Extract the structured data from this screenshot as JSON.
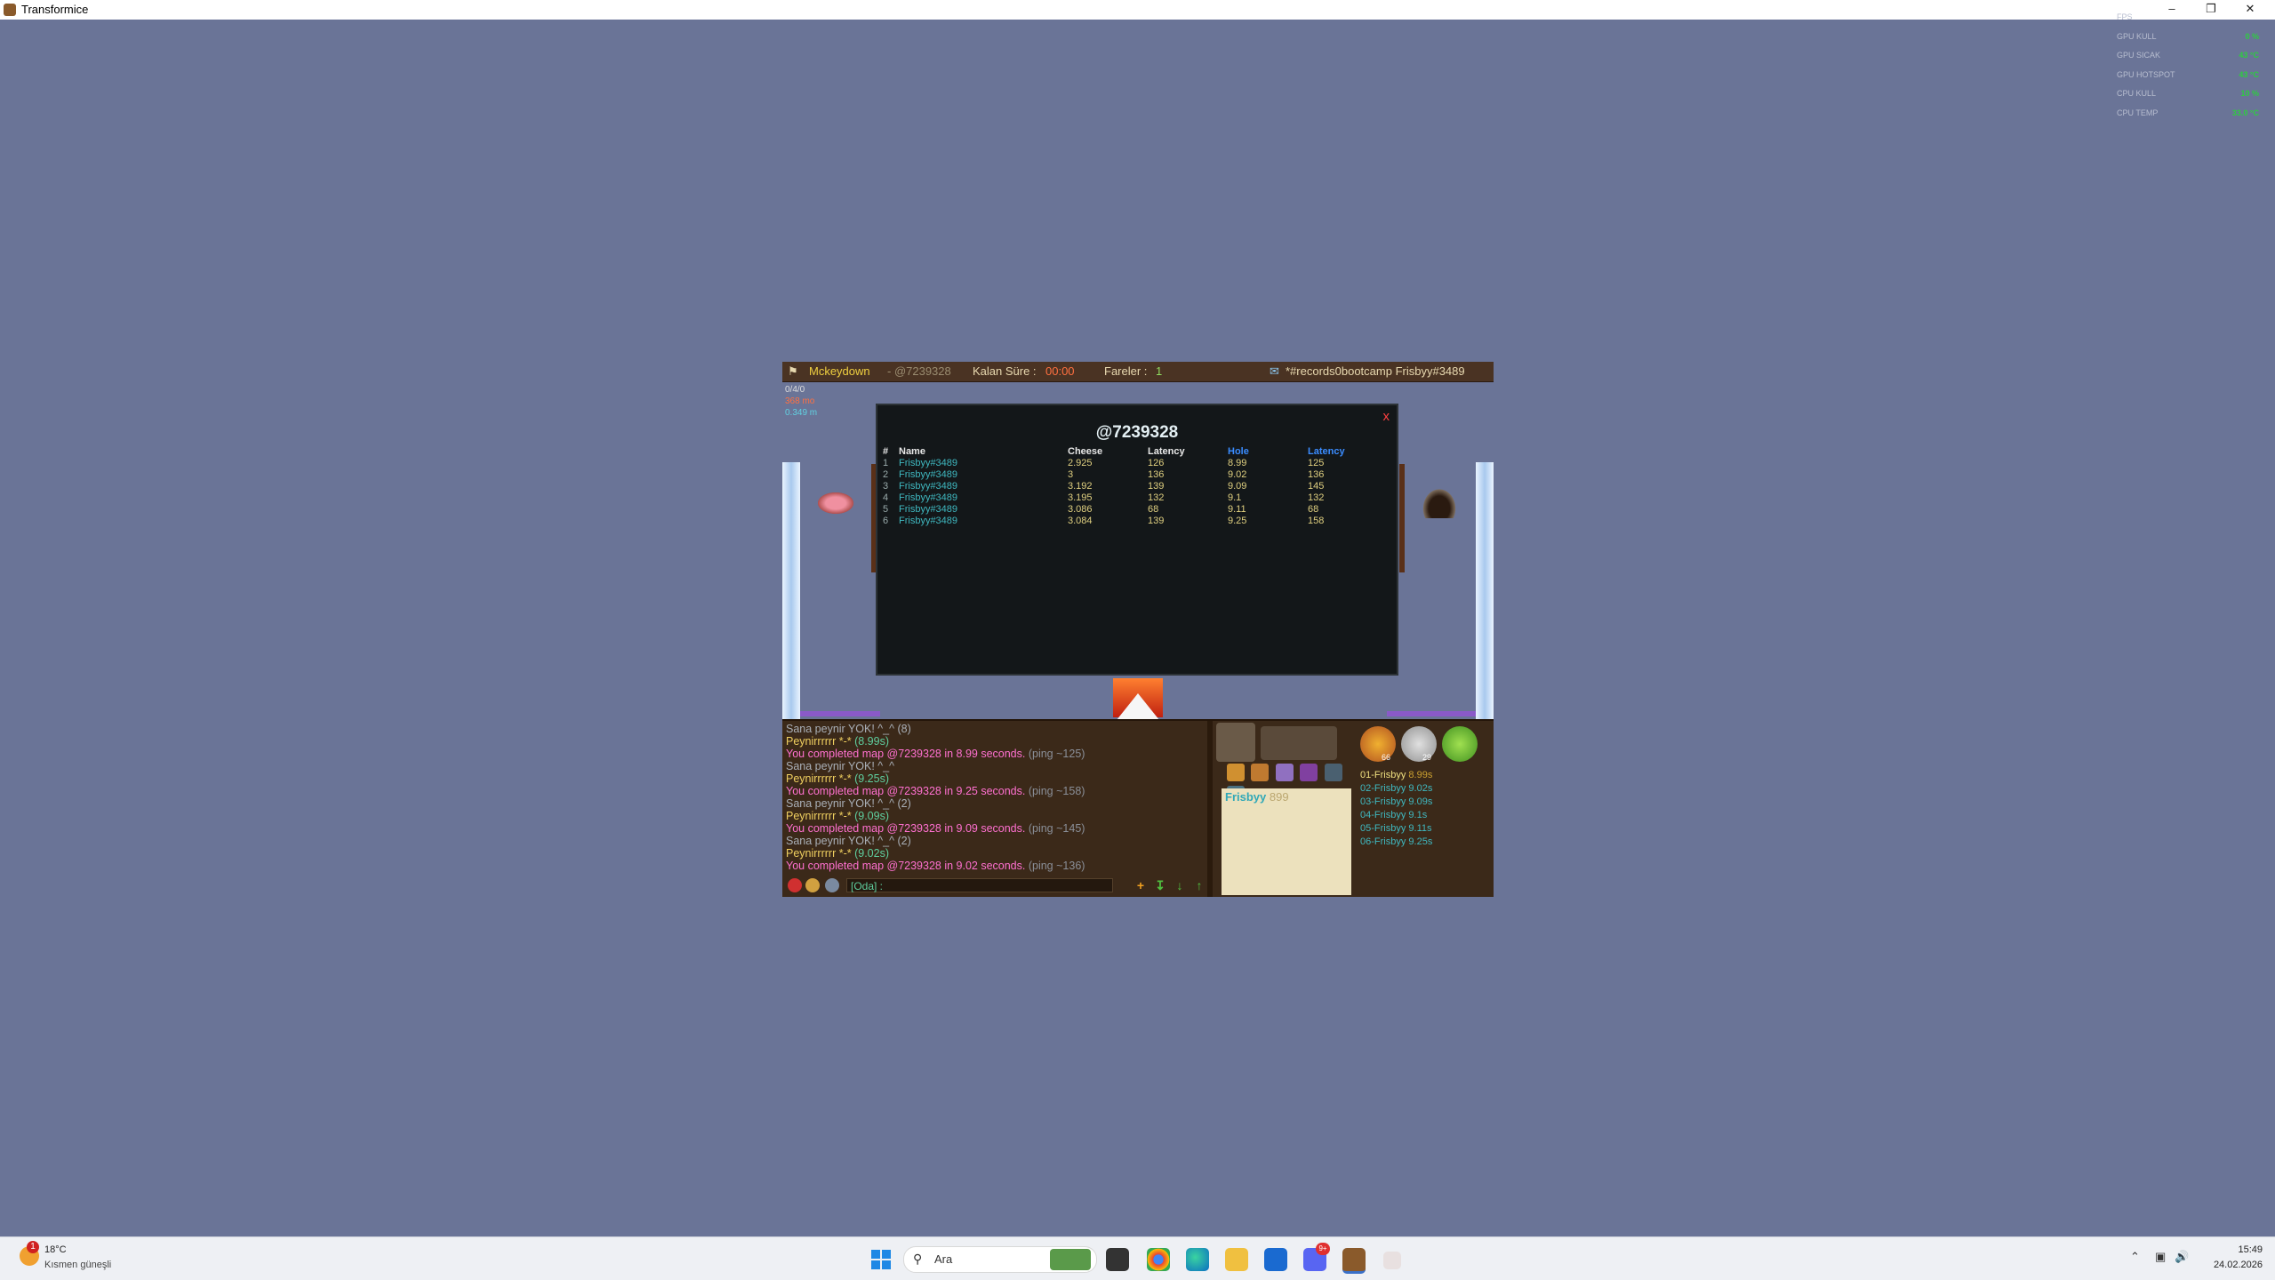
{
  "window": {
    "title": "Transformice"
  },
  "overlay": {
    "rows": [
      {
        "label": "FPS",
        "value": ""
      },
      {
        "label": "GPU KULL",
        "value": "0 %"
      },
      {
        "label": "GPU SICAK",
        "value": "43 °C"
      },
      {
        "label": "GPU HOTSPOT",
        "value": "43 °C"
      },
      {
        "label": "CPU KULL",
        "value": "10 %"
      },
      {
        "label": "CPU TEMP",
        "value": "33.0 °C"
      }
    ]
  },
  "game": {
    "topbar": {
      "map_author": "Mckeydown",
      "map_code": "- @7239328",
      "time_label": "Kalan Süre :",
      "time_value": "00:00",
      "mice_label": "Fareler :",
      "mice_value": "1",
      "room": "*#records0bootcamp Frisbyy#3489"
    },
    "small_stats": [
      "0/4/0",
      "368 mo",
      "0.349 m"
    ],
    "records": {
      "title": "@7239328",
      "close": "x",
      "headers": [
        "#",
        "Name",
        "Cheese",
        "Latency",
        "Hole",
        "Latency"
      ],
      "rows": [
        [
          "1",
          "Frisbyy#3489",
          "2.925",
          "126",
          "8.99",
          "125"
        ],
        [
          "2",
          "Frisbyy#3489",
          "3",
          "136",
          "9.02",
          "136"
        ],
        [
          "3",
          "Frisbyy#3489",
          "3.192",
          "139",
          "9.09",
          "145"
        ],
        [
          "4",
          "Frisbyy#3489",
          "3.195",
          "132",
          "9.1",
          "132"
        ],
        [
          "5",
          "Frisbyy#3489",
          "3.086",
          "68",
          "9.11",
          "68"
        ],
        [
          "6",
          "Frisbyy#3489",
          "3.084",
          "139",
          "9.25",
          "158"
        ]
      ]
    },
    "chat": [
      {
        "type": "grey",
        "text": "Sana peynir YOK! ^_^ (8)"
      },
      {
        "type": "yg",
        "a": "Peynirrrrrr *-* ",
        "b": "(8.99s)"
      },
      {
        "type": "pink",
        "a": "You completed map @7239328 in 8.99 seconds. ",
        "b": "(ping ~125)"
      },
      {
        "type": "grey",
        "text": "Sana peynir YOK! ^_^"
      },
      {
        "type": "yg",
        "a": "Peynirrrrrr *-* ",
        "b": "(9.25s)"
      },
      {
        "type": "pink",
        "a": "You completed map @7239328 in 9.25 seconds. ",
        "b": "(ping ~158)"
      },
      {
        "type": "grey",
        "text": "Sana peynir YOK! ^_^ (2)"
      },
      {
        "type": "yg",
        "a": "Peynirrrrrr *-* ",
        "b": "(9.09s)"
      },
      {
        "type": "pink",
        "a": "You completed map @7239328 in 9.09 seconds. ",
        "b": "(ping ~145)"
      },
      {
        "type": "grey",
        "text": "Sana peynir YOK! ^_^ (2)"
      },
      {
        "type": "yg",
        "a": "Peynirrrrrr *-* ",
        "b": "(9.02s)"
      },
      {
        "type": "pink",
        "a": "You completed map @7239328 in 9.02 seconds. ",
        "b": "(ping ~136)"
      }
    ],
    "chat_input": {
      "value": "[Oda] :"
    },
    "profile": {
      "name": "Frisbyy",
      "score": "899"
    },
    "badges": [
      {
        "count": "66"
      },
      {
        "count": "29"
      },
      {
        "count": ""
      }
    ],
    "ranking": [
      {
        "name": "01-Frisbyy",
        "time": "8.99s"
      },
      {
        "name": "02-Frisbyy",
        "time": "9.02s"
      },
      {
        "name": "03-Frisbyy",
        "time": "9.09s"
      },
      {
        "name": "04-Frisbyy",
        "time": "9.1s"
      },
      {
        "name": "05-Frisbyy",
        "time": "9.11s"
      },
      {
        "name": "06-Frisbyy",
        "time": "9.25s"
      }
    ]
  },
  "taskbar": {
    "weather": {
      "badge": "1",
      "temp": "18°C",
      "desc": "Kısmen güneşli"
    },
    "search_placeholder": "Ara",
    "discord_badge": "9+",
    "time": "15:49",
    "date": "24.02.2026"
  }
}
